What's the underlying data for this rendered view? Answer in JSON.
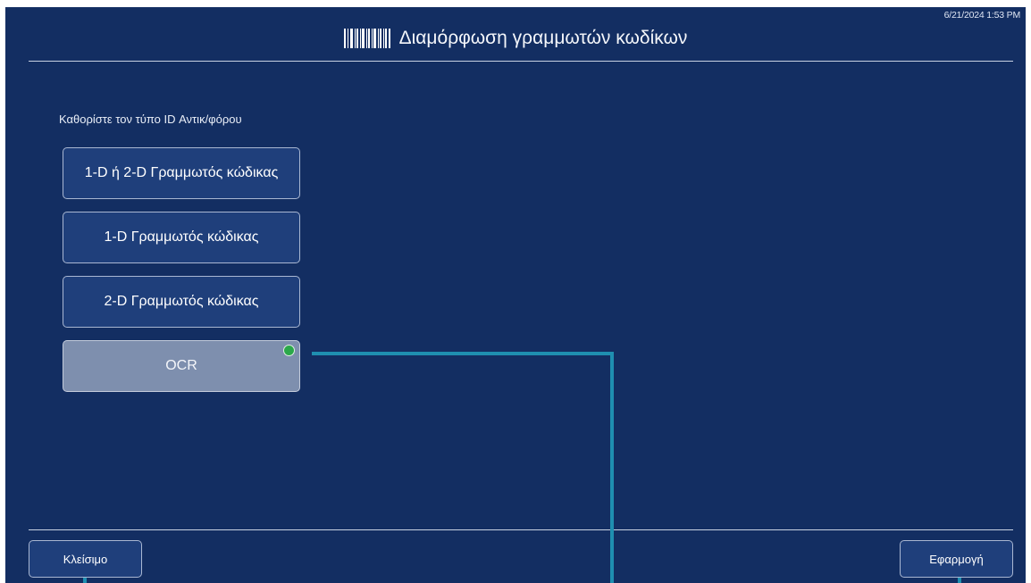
{
  "header": {
    "timestamp": "6/21/2024 1:53 PM",
    "title": "Διαμόρφωση γραμμωτών κωδίκων",
    "title_icon": "barcode-icon"
  },
  "main": {
    "prompt": "Καθορίστε τον τύπο ID Αντικ/φόρου",
    "options": [
      {
        "label": "1-D ή 2-D Γραμμωτός κώδικας",
        "selected": false
      },
      {
        "label": "1-D Γραμμωτός κώδικας",
        "selected": false
      },
      {
        "label": "2-D Γραμμωτός κώδικας",
        "selected": false
      },
      {
        "label": "OCR",
        "selected": true
      }
    ]
  },
  "footer": {
    "close_label": "Κλείσιμο",
    "apply_label": "Εφαρμογή"
  },
  "colors": {
    "background": "#132e62",
    "button": "#1f3f7b",
    "selected_button": "#7e8fae",
    "indicator": "#2ba84a",
    "callout": "#1f8fb0"
  }
}
